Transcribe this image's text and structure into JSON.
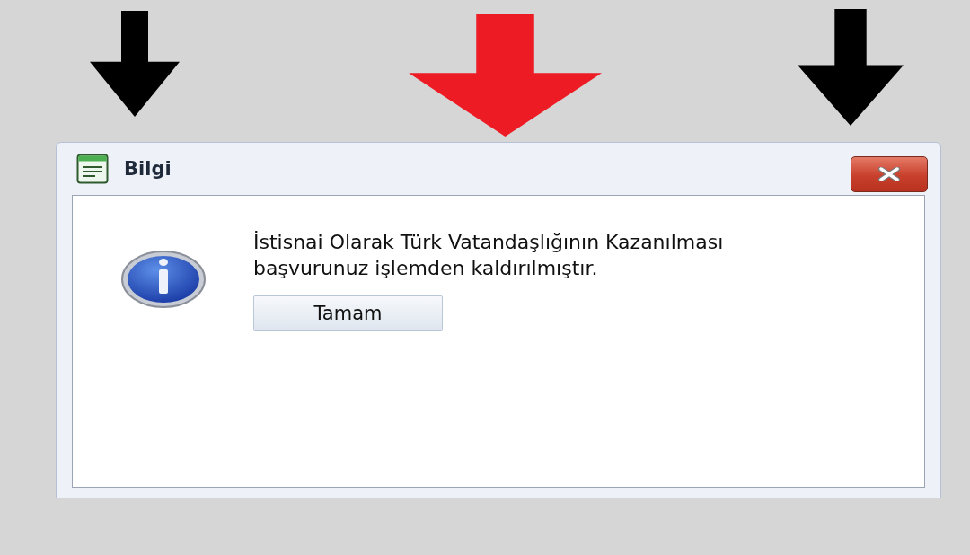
{
  "window": {
    "title": "Bilgi"
  },
  "message": "İstisnai Olarak Türk Vatandaşlığının Kazanılması başvurunuz işlemden kaldırılmıştır.",
  "buttons": [
    "Tamam"
  ],
  "annotations": [
    {
      "kind": "arrow",
      "color": "#000000"
    },
    {
      "kind": "arrow",
      "color": "#ed1c24"
    },
    {
      "kind": "arrow",
      "color": "#000000"
    }
  ]
}
